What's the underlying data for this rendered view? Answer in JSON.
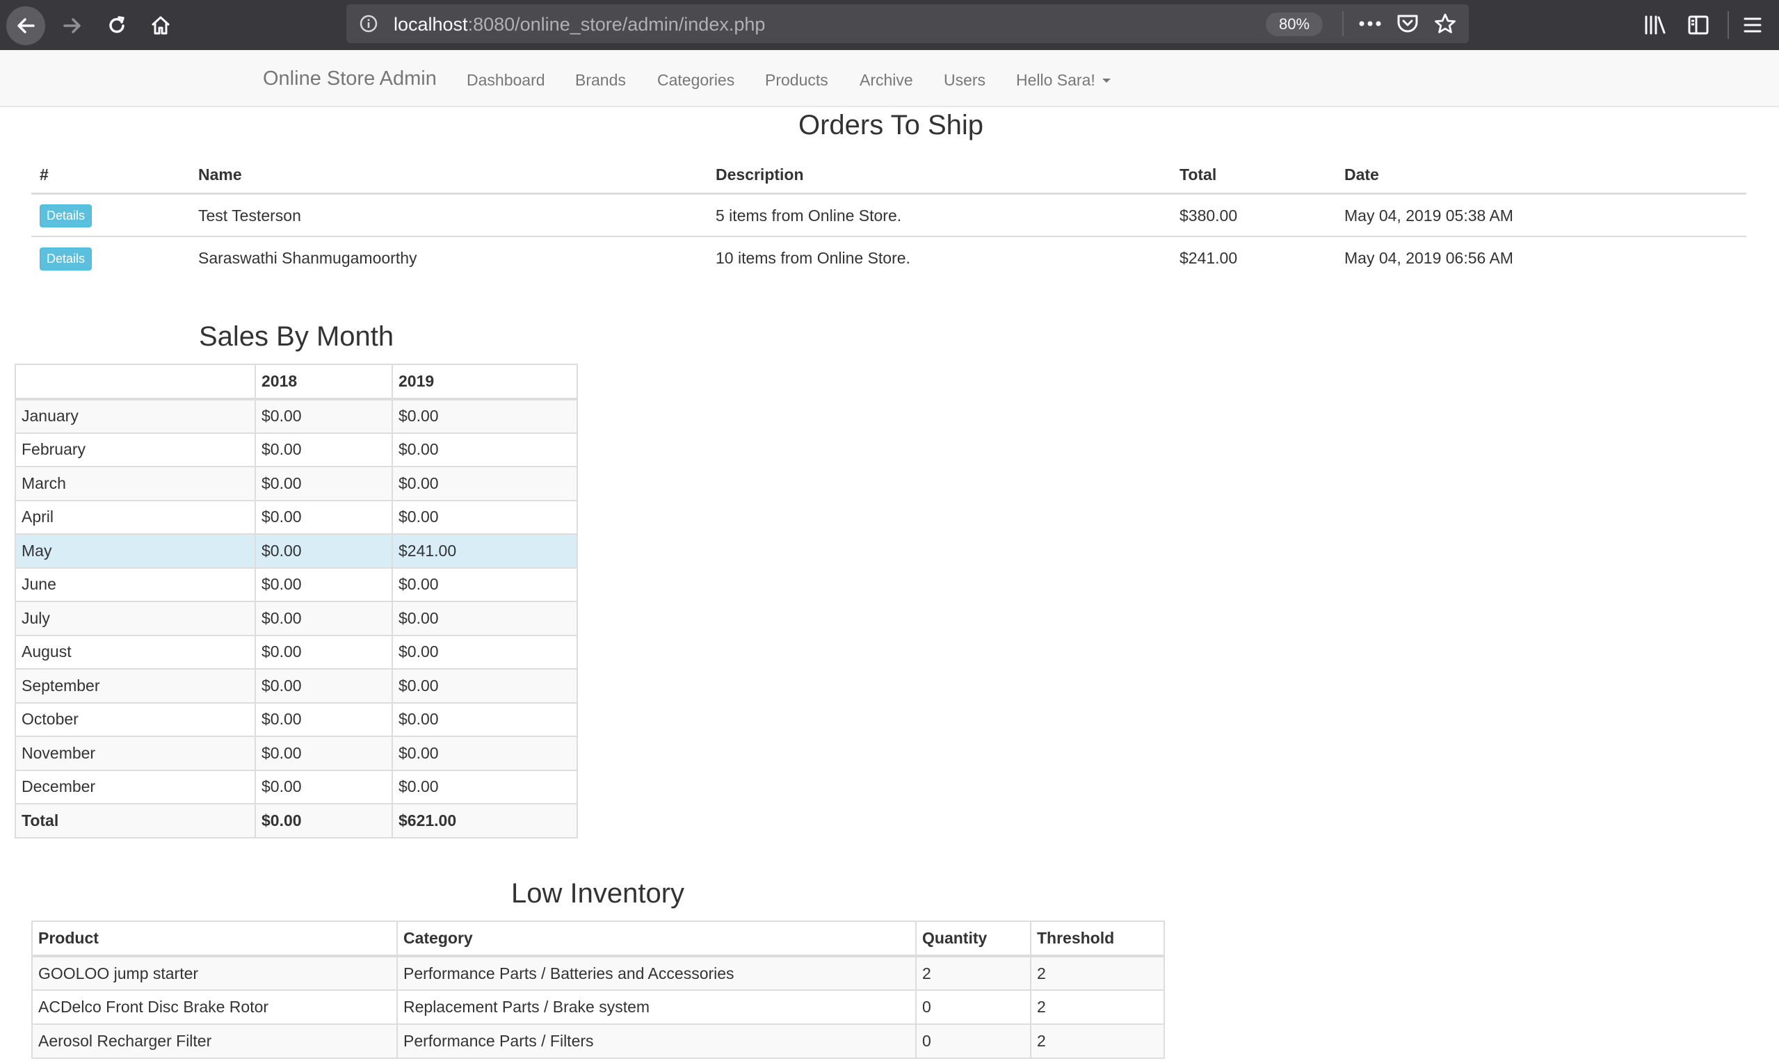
{
  "browser": {
    "url_host": "localhost",
    "url_path": ":8080/online_store/admin/index.php",
    "zoom": "80%"
  },
  "navbar": {
    "brand": "Online Store Admin",
    "links": [
      "Dashboard",
      "Brands",
      "Categories",
      "Products",
      "Archive",
      "Users"
    ],
    "user_menu": "Hello Sara!"
  },
  "orders": {
    "title": "Orders To Ship",
    "headers": [
      "#",
      "Name",
      "Description",
      "Total",
      "Date"
    ],
    "details_label": "Details",
    "rows": [
      {
        "name": "Test Testerson",
        "description": "5 items from Online Store.",
        "total": "$380.00",
        "date": "May 04, 2019 05:38 AM"
      },
      {
        "name": "Saraswathi Shanmugamoorthy",
        "description": "10 items from Online Store.",
        "total": "$241.00",
        "date": "May 04, 2019 06:56 AM"
      }
    ]
  },
  "sales": {
    "title": "Sales By Month",
    "headers": [
      "",
      "2018",
      "2019"
    ],
    "rows": [
      [
        "January",
        "$0.00",
        "$0.00"
      ],
      [
        "February",
        "$0.00",
        "$0.00"
      ],
      [
        "March",
        "$0.00",
        "$0.00"
      ],
      [
        "April",
        "$0.00",
        "$0.00"
      ],
      [
        "May",
        "$0.00",
        "$241.00"
      ],
      [
        "June",
        "$0.00",
        "$0.00"
      ],
      [
        "July",
        "$0.00",
        "$0.00"
      ],
      [
        "August",
        "$0.00",
        "$0.00"
      ],
      [
        "September",
        "$0.00",
        "$0.00"
      ],
      [
        "October",
        "$0.00",
        "$0.00"
      ],
      [
        "November",
        "$0.00",
        "$0.00"
      ],
      [
        "December",
        "$0.00",
        "$0.00"
      ],
      [
        "Total",
        "$0.00",
        "$621.00"
      ]
    ],
    "highlight_month": "May"
  },
  "inventory": {
    "title": "Low Inventory",
    "headers": [
      "Product",
      "Category",
      "Quantity",
      "Threshold"
    ],
    "rows": [
      [
        "GOOLOO jump starter",
        "Performance Parts / Batteries and Accessories",
        "2",
        "2"
      ],
      [
        "ACDelco Front Disc Brake Rotor",
        "Replacement Parts / Brake system",
        "0",
        "2"
      ],
      [
        "Aerosol Recharger Filter",
        "Performance Parts / Filters",
        "0",
        "2"
      ]
    ]
  },
  "colors": {
    "browser_bar": "#38383d",
    "info_button": "#5bc0de",
    "highlight_row": "#d9edf7"
  }
}
